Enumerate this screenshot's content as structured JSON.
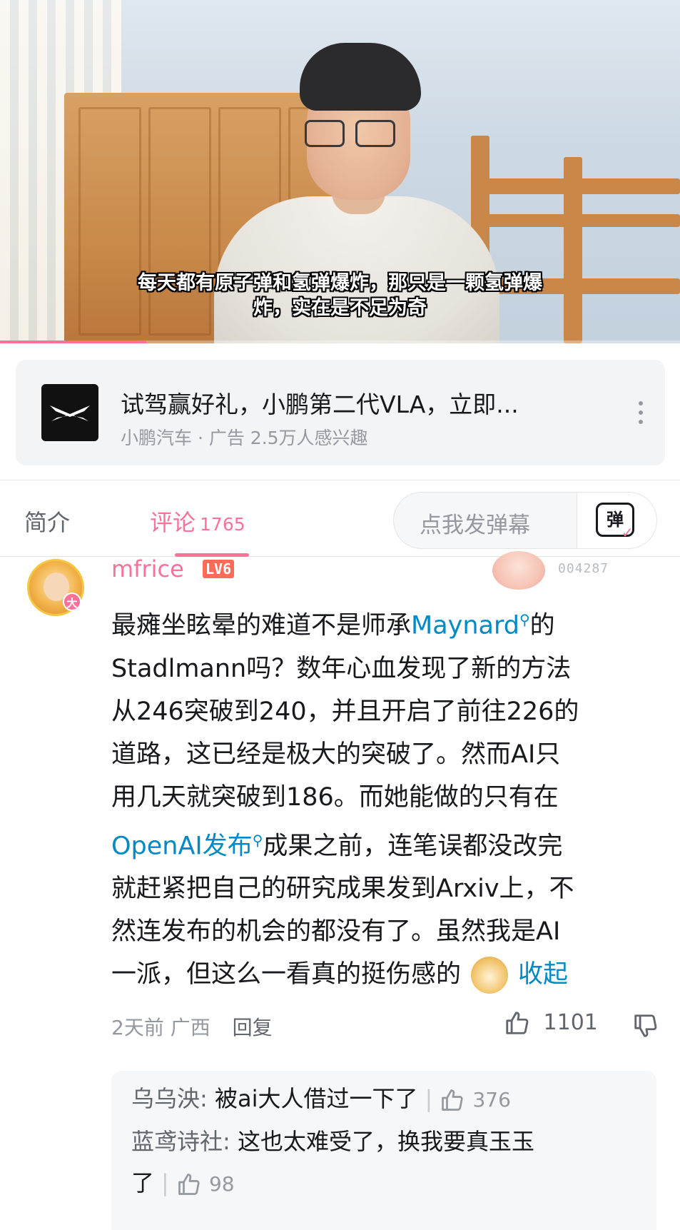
{
  "video": {
    "subtitle_line1": "每天都有原子弹和氢弹爆炸，那只是一颗氢弹爆",
    "subtitle_line2": "炸，实在是不足为奇",
    "progress_fraction": 0.215
  },
  "ad": {
    "title": "试驾赢好礼，小鹏第二代VLA，立即...",
    "subtitle": "小鹏汽车 · 广告  2.5万人感兴趣",
    "logo_icon": "xpeng-logo-icon"
  },
  "tabs": {
    "intro_label": "简介",
    "comment_label": "评论",
    "comment_count": "1765",
    "danmaku_placeholder": "点我发弹幕",
    "danmaku_button_glyph": "弹"
  },
  "comment": {
    "username": "mfrice",
    "level": "LV6",
    "avatar_badge": "大",
    "fan_number": "004287",
    "body": {
      "line1_pre": "最瘫坐眩晕的难道不是师承",
      "line1_link": "Maynard",
      "line1_post": "的",
      "line2": "Stadlmann吗？数年心血发现了新的方法",
      "line3": "从246突破到240，并且开启了前往226的",
      "line4": "道路，这已经是极大的突破了。然而AI只",
      "line5": "用几天就突破到186。而她能做的只有在",
      "line6_link": "OpenAI发布",
      "line6_post": "成果之前，连笔误都没改完",
      "line7": "就赶紧把自己的研究成果发到Arxiv上，不",
      "line8": "然连发布的机会的都没有了。虽然我是AI",
      "line9": "一派，但这么一看真的挺伤感的",
      "collapse": "收起"
    },
    "time": "2天前",
    "location": "广西",
    "reply_label": "回复",
    "likes": "1101"
  },
  "sub_replies": [
    {
      "user": "乌乌泱",
      "text": "被ai大人借过一下了",
      "likes": "376"
    },
    {
      "user": "蓝鸢诗社",
      "text": "这也太难受了，换我要真玉玉",
      "text_cont": "了",
      "likes": "98"
    }
  ],
  "colors": {
    "accent_pink": "#fb7299",
    "link_blue": "#008ac5",
    "text_gray": "#9499a0"
  }
}
